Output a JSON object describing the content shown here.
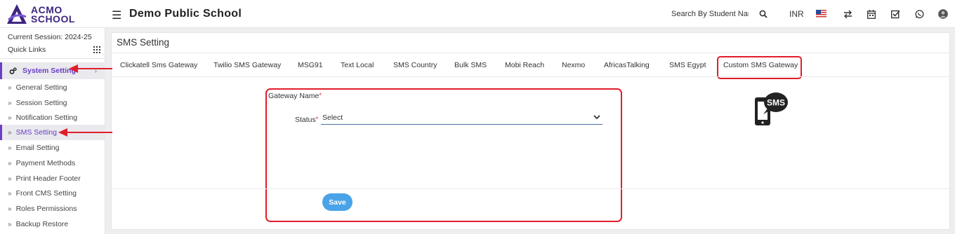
{
  "app": {
    "logo_text_line1": "ACMO",
    "logo_text_line2": "SCHOOL",
    "school_name": "Demo Public School"
  },
  "header": {
    "search_placeholder": "Search By Student Name",
    "currency": "INR",
    "icons": [
      "search-icon",
      "us-flag-icon",
      "swap-icon",
      "calendar-icon",
      "checkbox-icon",
      "whatsapp-icon",
      "user-avatar"
    ]
  },
  "sidebar": {
    "session": "Current Session: 2024-25",
    "quick_links": "Quick Links",
    "section": "System Setting",
    "items": [
      {
        "label": "General Setting"
      },
      {
        "label": "Session Setting"
      },
      {
        "label": "Notification Setting"
      },
      {
        "label": "SMS Setting"
      },
      {
        "label": "Email Setting"
      },
      {
        "label": "Payment Methods"
      },
      {
        "label": "Print Header Footer"
      },
      {
        "label": "Front CMS Setting"
      },
      {
        "label": "Roles Permissions"
      },
      {
        "label": "Backup Restore"
      }
    ],
    "active_item": "SMS Setting"
  },
  "main": {
    "title": "SMS Setting",
    "tabs": [
      {
        "label": "Clickatell Sms Gateway"
      },
      {
        "label": "Twilio SMS Gateway"
      },
      {
        "label": "MSG91"
      },
      {
        "label": "Text Local"
      },
      {
        "label": "SMS Country"
      },
      {
        "label": "Bulk SMS"
      },
      {
        "label": "Mobi Reach"
      },
      {
        "label": "Nexmo"
      },
      {
        "label": "AfricasTalking"
      },
      {
        "label": "SMS Egypt"
      },
      {
        "label": "Custom SMS Gateway"
      }
    ],
    "active_tab": "Custom SMS Gateway",
    "form": {
      "gateway_name_label": "Gateway Name",
      "status_label": "Status",
      "required_mark": "*",
      "status_value": "Select",
      "save_label": "Save"
    },
    "graphic_text": "SMS"
  },
  "colors": {
    "accent": "#6a3fc4",
    "annotation_red": "#e11d2a",
    "save_button": "#4aa3e8"
  }
}
